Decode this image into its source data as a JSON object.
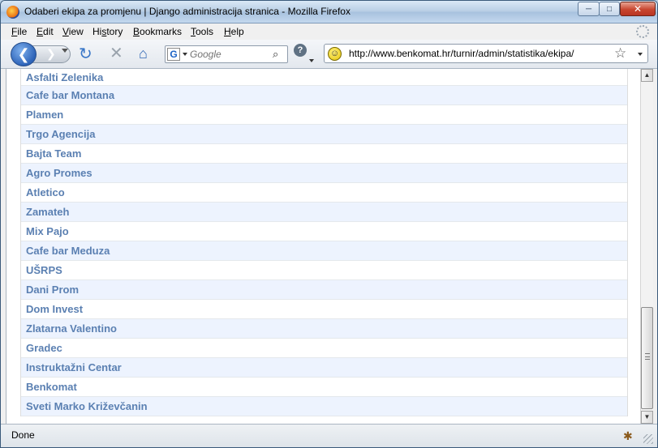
{
  "window": {
    "title": "Odaberi ekipa za promjenu | Django administracija stranica - Mozilla Firefox",
    "minimize_glyph": "─",
    "maximize_glyph": "□",
    "close_glyph": "✕"
  },
  "menu": [
    {
      "u": "F",
      "rest": "ile"
    },
    {
      "u": "E",
      "rest": "dit"
    },
    {
      "u": "V",
      "rest": "iew"
    },
    {
      "pre": "Hi",
      "u": "s",
      "rest": "tory"
    },
    {
      "u": "B",
      "rest": "ookmarks"
    },
    {
      "u": "T",
      "rest": "ools"
    },
    {
      "u": "H",
      "rest": "elp"
    }
  ],
  "toolbar": {
    "back_icon": "back-arrow-icon",
    "forward_icon": "forward-arrow-icon",
    "reload_icon": "reload-icon",
    "stop_icon": "stop-icon",
    "home_icon": "home-icon",
    "search_engine_letter": "G",
    "search_placeholder": "Google",
    "url": "http://www.benkomat.hr/turnir/admin/statistika/ekipa/"
  },
  "results": [
    "Asfalti Zelenika",
    "Cafe bar Montana",
    "Plamen",
    "Trgo Agencija",
    "Bajta Team",
    "Agro Promes",
    "Atletico",
    "Zamateh",
    "Mix Pajo",
    "Cafe bar Meduza",
    "UŠRPS",
    "Dani Prom",
    "Dom Invest",
    "Zlatarna Valentino",
    "Gradec",
    "Instruktažni Centar",
    "Benkomat",
    "Sveti Marko Križevčanin"
  ],
  "colors": {
    "link": "#5b80b2",
    "row_alt": "#edf3fe"
  },
  "statusbar": {
    "text": "Done"
  }
}
